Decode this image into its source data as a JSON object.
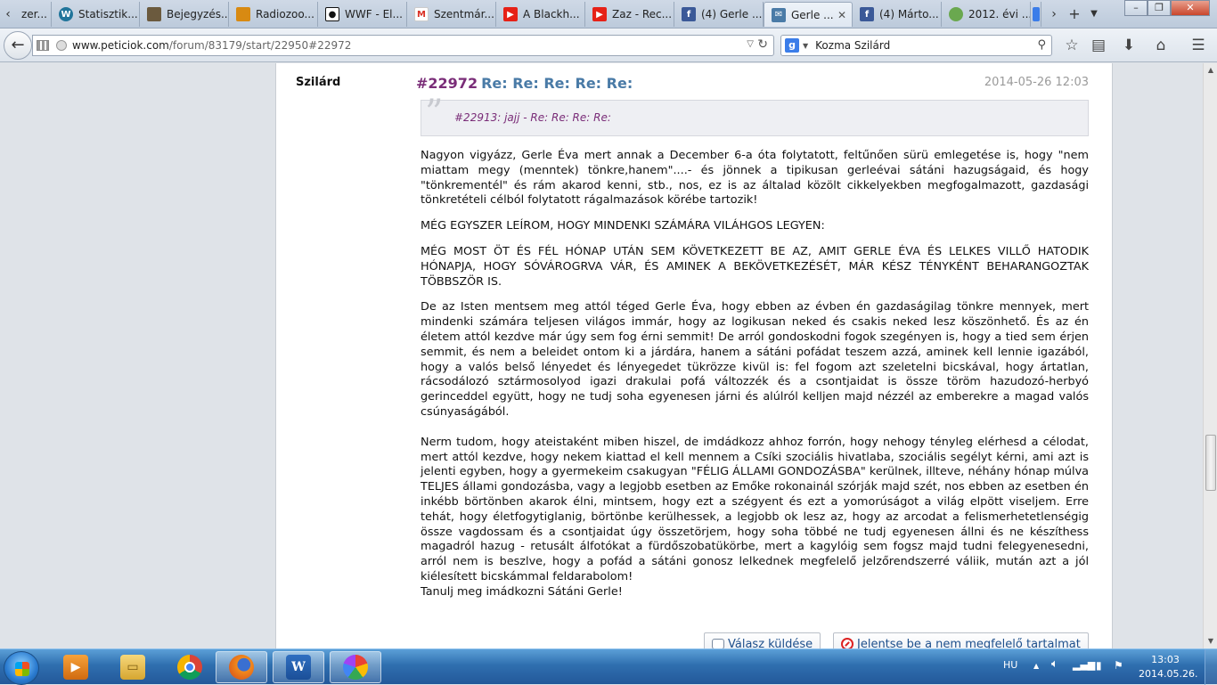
{
  "browser": {
    "tabs": [
      {
        "label": "zer...",
        "icon": "generic-icon",
        "color": "#c36a2d"
      },
      {
        "label": "Statisztik...",
        "icon": "wordpress-icon",
        "color": "#21759b"
      },
      {
        "label": "Bejegyzés...",
        "icon": "thumbnail-icon",
        "color": "#6b5a3e"
      },
      {
        "label": "Radiozoo...",
        "icon": "thumbnail-icon",
        "color": "#d88a12"
      },
      {
        "label": "WWF - El...",
        "icon": "panda-icon",
        "color": "#111111"
      },
      {
        "label": "Szentmár...",
        "icon": "gmail-icon",
        "color": "#d93025"
      },
      {
        "label": "A Blackh...",
        "icon": "youtube-icon",
        "color": "#e62117"
      },
      {
        "label": "Zaz - Rec...",
        "icon": "youtube-icon",
        "color": "#e62117"
      },
      {
        "label": "(4) Gerle ...",
        "icon": "facebook-icon",
        "color": "#3b5998"
      },
      {
        "label": "Gerle ...",
        "icon": "forum-icon",
        "color": "#4a7ba7",
        "active": true
      },
      {
        "label": "(4) Márto...",
        "icon": "facebook-icon",
        "color": "#3b5998"
      },
      {
        "label": "2012. évi ...",
        "icon": "generic-icon",
        "color": "#6aa84f"
      }
    ],
    "url": {
      "domain": "www.peticiok.com",
      "path": "/forum/83179/start/22950#22972"
    },
    "search": {
      "engine_icon": "google-icon",
      "value": "Kozma Szilárd"
    }
  },
  "post": {
    "author": "Szilárd",
    "number": "#22972",
    "title": "Re: Re: Re: Re: Re:",
    "date": "2014-05-26 12:03",
    "quote": "#22913: jajj - Re: Re: Re: Re:",
    "paragraphs": [
      "Nagyon vigyázz, Gerle Éva mert annak a December 6-a óta folytatott, feltűnően sürü emlegetése is, hogy \"nem miattam megy (menntek) tönkre,hanem\"....- és jönnek a tipikusan gerleévai sátáni hazugságaid, és hogy \"tönkrementél\" és rám akarod kenni, stb., nos, ez is az általad közölt cikkelyekben megfogalmazott, gazdasági tönkretételi célból folytatott rágalmazások körébe tartozik!",
      "MÉG EGYSZER LEÍROM, HOGY MINDENKI SZÁMÁRA VILÁHGOS LEGYEN:",
      "MÉG MOST ÖT ÉS FÉL HÓNAP UTÁN SEM KÖVETKEZETT BE AZ, AMIT GERLE ÉVA ÉS LELKES VILLŐ HATODIK HÓNAPJA, HOGY SÓVÁROGRVA VÁR, ÉS AMINEK A BEKÖVETKEZÉSÉT, MÁR KÉSZ TÉNYKÉNT BEHARANGOZTAK TÖBBSZÖR IS.",
      "De az Isten mentsem meg attól téged Gerle Éva, hogy ebben az évben én gazdaságilag tönkre mennyek, mert mindenki számára teljesen világos immár, hogy az logikusan neked és csakis neked lesz köszönhető. És az én életem attól kezdve már úgy sem fog érni semmit! De arról gondoskodni fogok szegényen is, hogy a tied sem érjen semmit, és nem a beleidet ontom ki a járdára, hanem a sátáni pofádat teszem azzá, aminek kell lennie igazából, hogy a valós belső lényedet és lényegedet tükrözze kivül is: fel fogom azt szeletelni bicskával, hogy ártatlan, rácsodálozó sztármosolyod igazi drakulai pofá változzék és a csontjaidat is össze töröm hazudozó-herbyó gerinceddel együtt, hogy ne tudj soha egyenesen járni és alúlról kelljen majd nézzél az emberekre a magad valós csúnyaságából.",
      "Nerm tudom, hogy ateistaként miben hiszel, de imdádkozz ahhoz forrón, hogy nehogy tényleg elérhesd a célodat, mert attól kezdve, hogy nekem kiattad el kell mennem a Csíki szociális hivatlaba, szociális segélyt kérni, ami azt is jelenti egyben, hogy a gyermekeim csakugyan \"FÉLIG ÁLLAMI GONDOZÁSBA\" kerülnek, illteve, néhány hónap múlva TELJES állami gondozásba, vagy a legjobb esetben az Emőke rokonainál szórják majd szét, nos ebben az esetben én inkébb börtönben akarok élni, mintsem, hogy ezt a szégyent és ezt a yomorúságot a világ elpött viseljem. Erre tehát, hogy életfogytiglanig,  börtönbe kerülhessek, a legjobb ok lesz az, hogy az arcodat a felismerhetetlenségig össze vagdossam és a csontjaidat úgy összetörjem, hogy soha többé ne tudj egyenesen állni és ne készíthess magadról hazug - retusált álfotókat a fürdőszobatükörbe, mert a kagylóig sem fogsz majd tudni felegyenesedni, arról nem is beszlve, hogy a pofád a sátáni gonosz lelkednek megfelelő jelzőrendszerré váliik, mután azt a jól kiélesített bicskámmal feldarabolom!",
      "Tanulj meg imádkozni Sátáni Gerle!"
    ],
    "reply_button": "Válasz küldése",
    "report_button": "Jelentse be a nem megfelelő tartalmat"
  },
  "taskbar": {
    "language": "HU",
    "time": "13:03",
    "date": "2014.05.26."
  },
  "colors": {
    "post_number": "#7a2d78",
    "post_title": "#4a7ba7",
    "link": "#1d4f8c"
  }
}
